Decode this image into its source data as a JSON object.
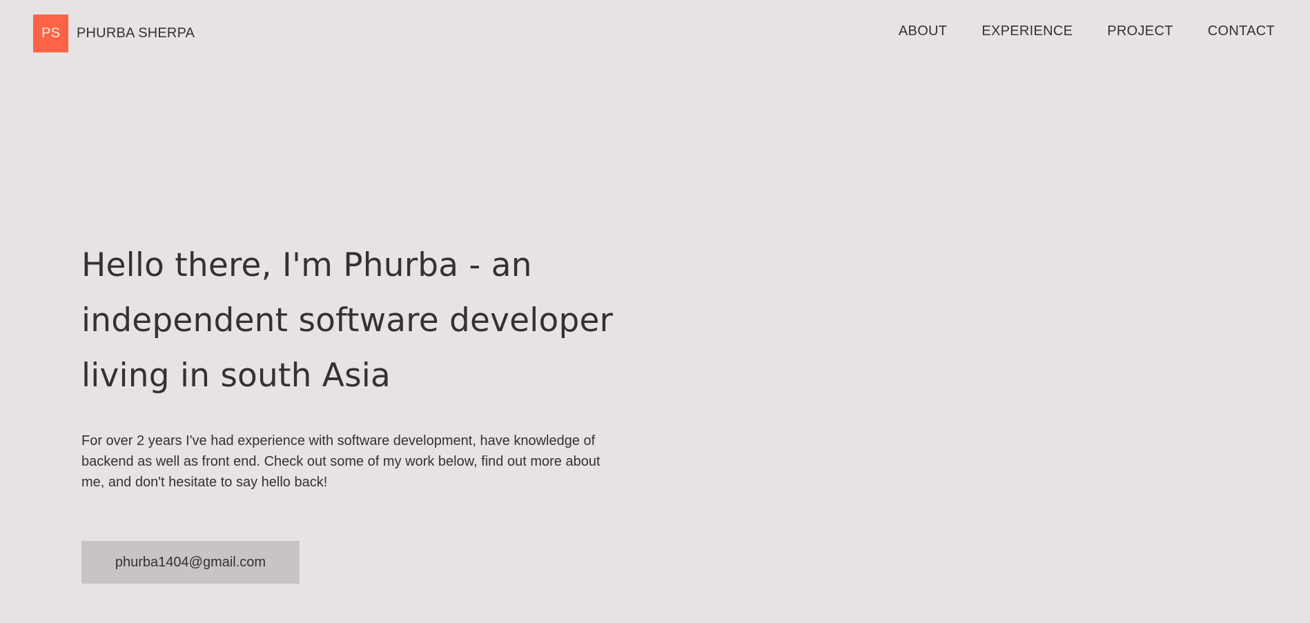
{
  "header": {
    "logo_text": "PS",
    "brand_name": "PHURBA SHERPA",
    "nav": [
      {
        "label": "ABOUT"
      },
      {
        "label": "EXPERIENCE"
      },
      {
        "label": "PROJECT"
      },
      {
        "label": "CONTACT"
      }
    ]
  },
  "hero": {
    "title": "Hello there, I'm Phurba - an independent software developer living in south Asia",
    "description": "For over 2 years I've had experience with software development, have knowledge of backend as well as front end. Check out some of my work below, find out more about me, and don't hesitate to say hello back!",
    "email_button": "phurba1404@gmail.com"
  },
  "colors": {
    "background": "#e7e3e2",
    "accent": "#ff6347",
    "text": "#333131",
    "button_bg": "#c8c4c3"
  }
}
